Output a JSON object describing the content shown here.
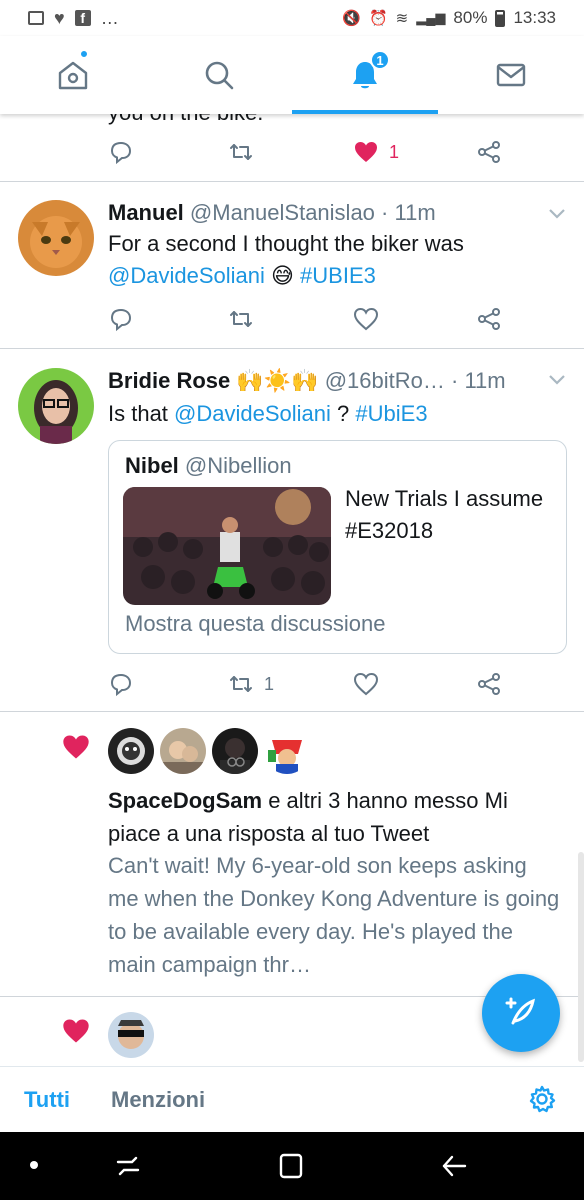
{
  "status_bar": {
    "battery": "80%",
    "time": "13:33",
    "more": "…"
  },
  "nav": {
    "notification_badge": "1"
  },
  "previous_tweet": {
    "cut_text": "you on the bike.",
    "likes": "1"
  },
  "tweet1": {
    "name": "Manuel",
    "handle": "@ManuelStanislao",
    "time": "· 11m",
    "text_start": "For a second I thought the biker was",
    "mention": "@DavideSoliani",
    "emoji": "😅",
    "hashtag": "#UBIE3"
  },
  "tweet2": {
    "name": "Bridie Rose",
    "name_emoji": "🙌☀️🙌",
    "handle": "@16bitRo…",
    "time": "· 11m",
    "text_prefix": "Is that",
    "mention": "@DavideSoliani",
    "text_mid": "?",
    "hashtag": "#UbiE3",
    "retweets": "1",
    "quote": {
      "name": "Nibel",
      "handle": "@Nibellion",
      "text": "New Trials I assume #E32018",
      "footer": "Mostra questa discussione"
    }
  },
  "notification": {
    "user": "SpaceDogSam",
    "action": "e altri 3 hanno messo Mi piace a una risposta al tuo Tweet",
    "snippet": "Can't wait! My 6-year-old son keeps asking me when the Donkey Kong Adventure is going to be available every day. He's played the main campaign thr…"
  },
  "bottom_tabs": {
    "all": "Tutti",
    "mentions": "Menzioni"
  },
  "colors": {
    "accent": "#1da1f2",
    "link": "#1b95e0",
    "like": "#e0245e",
    "muted": "#657786"
  }
}
